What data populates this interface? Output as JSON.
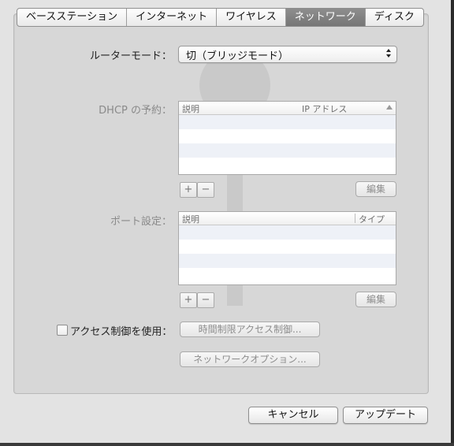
{
  "tabs": [
    {
      "label": "ベースステーション",
      "active": false
    },
    {
      "label": "インターネット",
      "active": false
    },
    {
      "label": "ワイヤレス",
      "active": false
    },
    {
      "label": "ネットワーク",
      "active": true
    },
    {
      "label": "ディスク",
      "active": false
    }
  ],
  "router_mode": {
    "label": "ルーターモード：",
    "value": "切（ブリッジモード）"
  },
  "dhcp": {
    "label": "DHCP の予約：",
    "columns": [
      "説明",
      "IP アドレス"
    ],
    "rows": [],
    "add_label": "+",
    "remove_label": "−",
    "edit_label": "編集"
  },
  "port": {
    "label": "ポート設定：",
    "columns": [
      "説明",
      "タイプ"
    ],
    "rows": [],
    "add_label": "+",
    "remove_label": "−",
    "edit_label": "編集"
  },
  "access_control": {
    "checkbox_label": "アクセス制御を使用：",
    "checked": false,
    "timed_button_label": "時間制限アクセス制御..."
  },
  "network_options_label": "ネットワークオプション...",
  "footer": {
    "cancel_label": "キャンセル",
    "update_label": "アップデート"
  },
  "colors": {
    "active_tab": "#7f7f7f",
    "panel_bg": "#d7d7d7",
    "table_stripe": "#eef1f7"
  }
}
